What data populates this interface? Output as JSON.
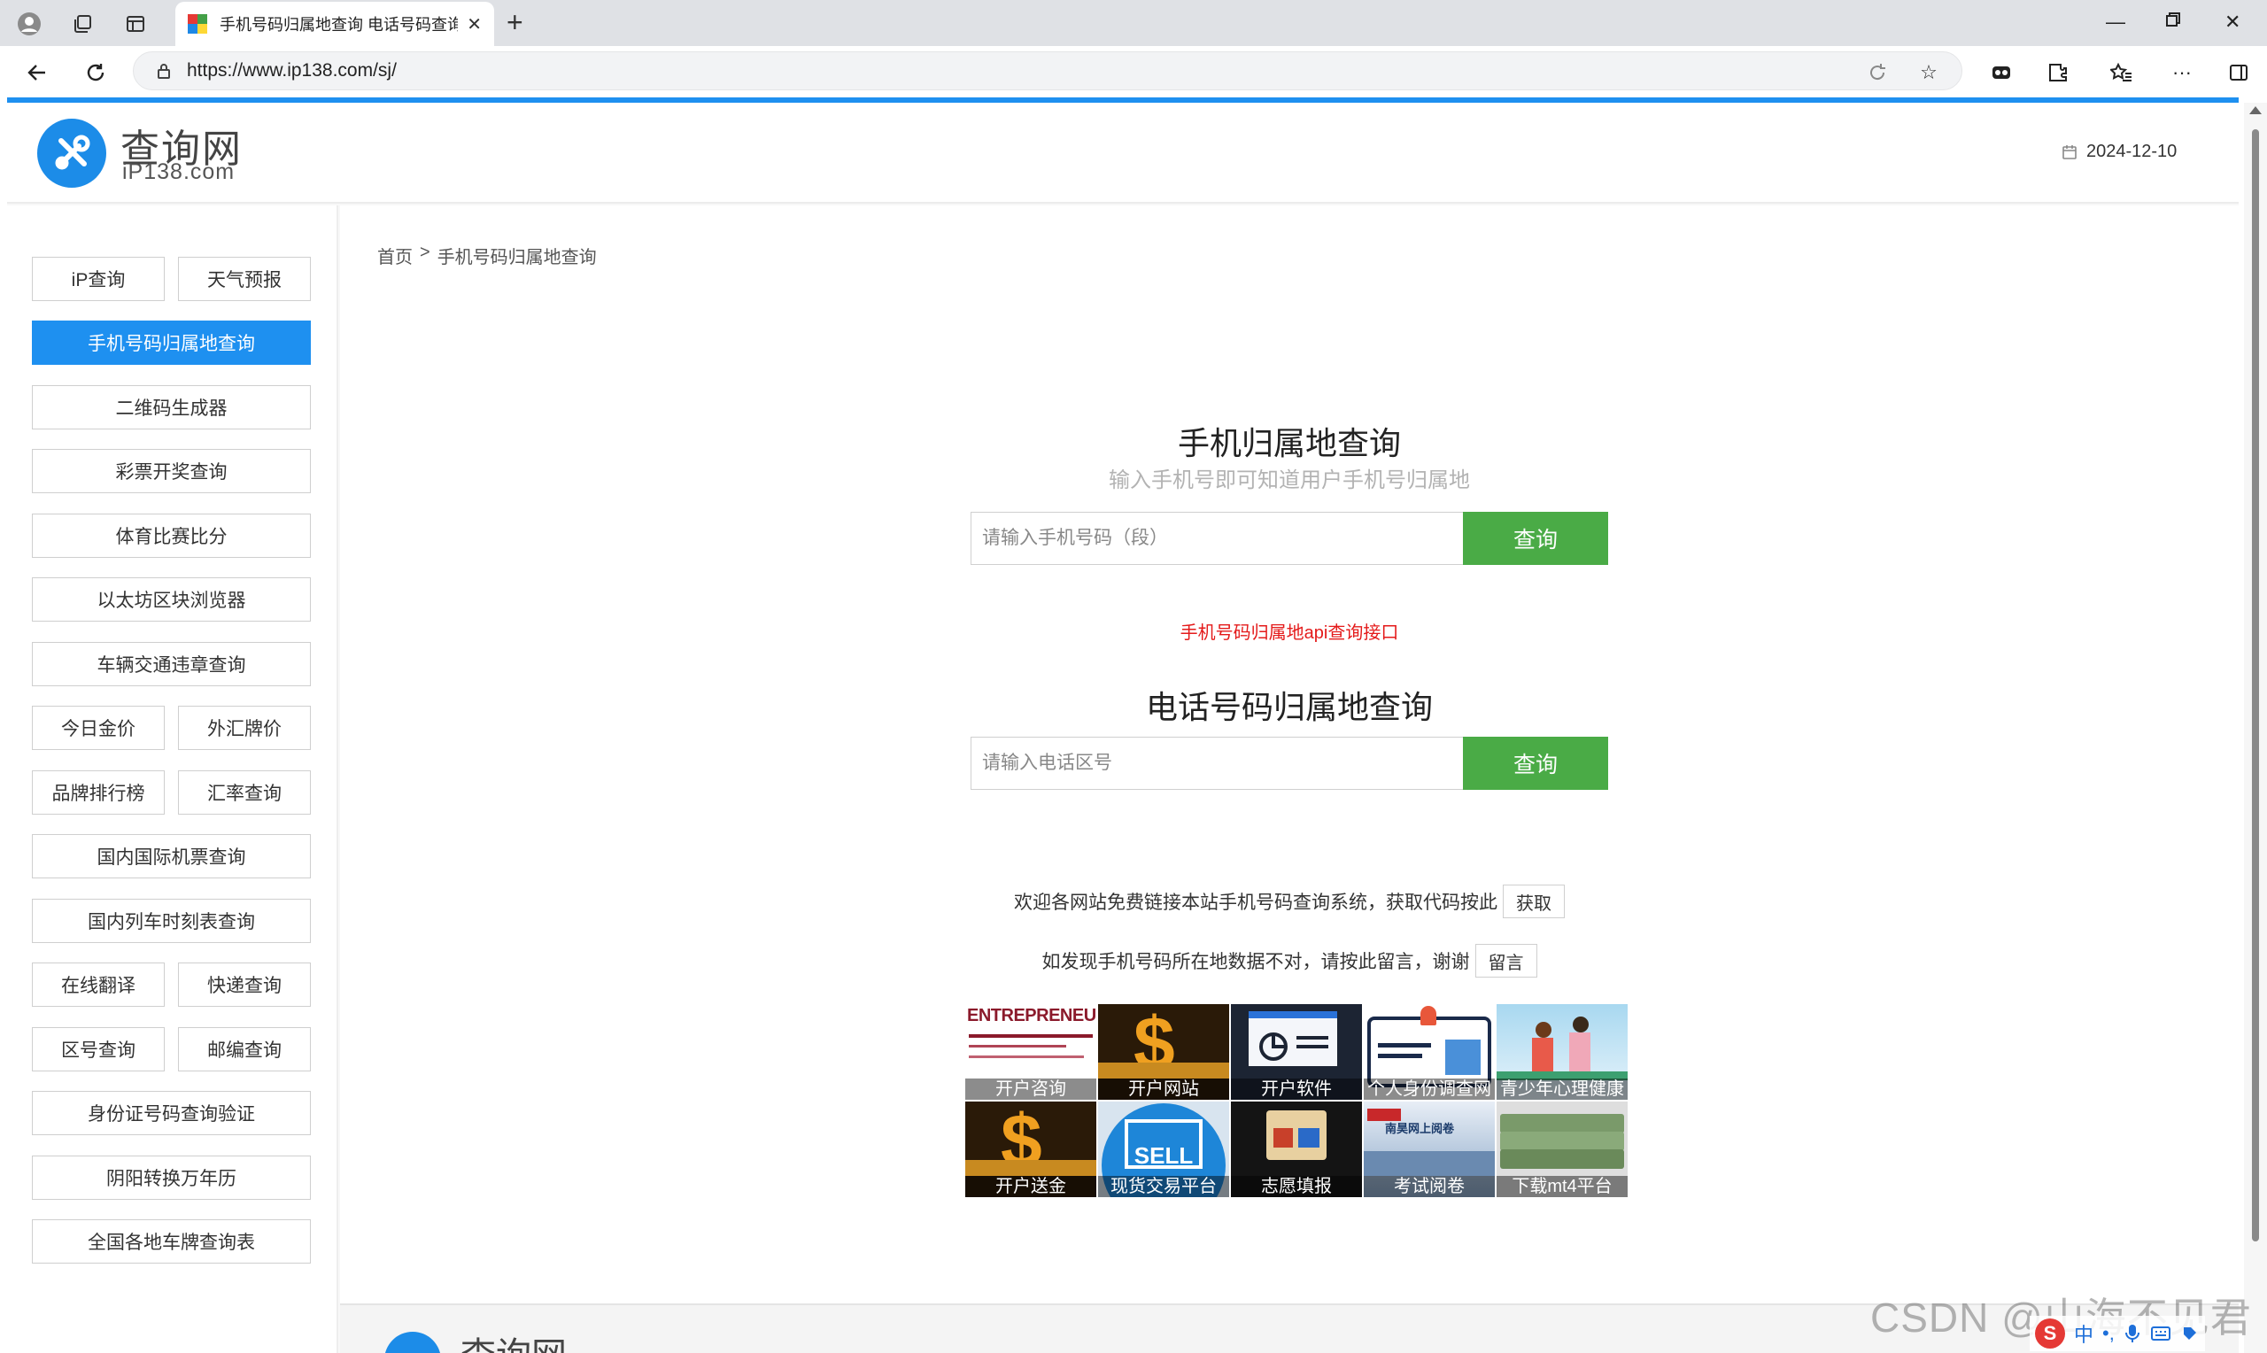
{
  "browser": {
    "tab_title": "手机号码归属地查询 电话号码查询",
    "url": "https://www.ip138.com/sj/"
  },
  "site": {
    "logo_cn": "查询网",
    "logo_en": "iP138.com",
    "date": "2024-12-10",
    "accent_color": "#1e90f0",
    "button_color": "#4aab46"
  },
  "sidebar": {
    "items": [
      {
        "label": "iP查询"
      },
      {
        "label": "天气预报"
      },
      {
        "label": "手机号码归属地查询",
        "active": true
      },
      {
        "label": "二维码生成器"
      },
      {
        "label": "彩票开奖查询"
      },
      {
        "label": "体育比赛比分"
      },
      {
        "label": "以太坊区块浏览器"
      },
      {
        "label": "车辆交通违章查询"
      },
      {
        "label": "今日金价"
      },
      {
        "label": "外汇牌价"
      },
      {
        "label": "品牌排行榜"
      },
      {
        "label": "汇率查询"
      },
      {
        "label": "国内国际机票查询"
      },
      {
        "label": "国内列车时刻表查询"
      },
      {
        "label": "在线翻译"
      },
      {
        "label": "快递查询"
      },
      {
        "label": "区号查询"
      },
      {
        "label": "邮编查询"
      },
      {
        "label": "身份证号码查询验证"
      },
      {
        "label": "阴阳转换万年历"
      },
      {
        "label": "全国各地车牌查询表"
      }
    ]
  },
  "breadcrumb": {
    "home": "首页",
    "separator": ">",
    "current": "手机号码归属地查询"
  },
  "mobile_query": {
    "title": "手机归属地查询",
    "subtitle": "输入手机号即可知道用户手机号归属地",
    "placeholder": "请输入手机号码（段）",
    "button": "查询"
  },
  "api_link": "手机号码归属地api查询接口",
  "phone_query": {
    "title": "电话号码归属地查询",
    "placeholder": "请输入电话区号",
    "button": "查询"
  },
  "notes": {
    "link_text": "欢迎各网站免费链接本站手机号码查询系统，获取代码按此",
    "link_button": "获取",
    "feedback_text": "如发现手机号码所在地数据不对，请按此留言，谢谢",
    "feedback_button": "留言"
  },
  "ads": [
    {
      "caption": "开户咨询",
      "banner": "ENTREPRENEUR"
    },
    {
      "caption": "开户网站"
    },
    {
      "caption": "开户软件"
    },
    {
      "caption": "个人身份调查网"
    },
    {
      "caption": "青少年心理健康"
    },
    {
      "caption": "开户送金"
    },
    {
      "caption": "现货交易平台",
      "banner": "SELL"
    },
    {
      "caption": "志愿填报"
    },
    {
      "caption": "考试阅卷",
      "banner": "南昊网上阅卷"
    },
    {
      "caption": "下载mt4平台"
    }
  ],
  "footer": {
    "logo_cn": "查询网"
  },
  "overlay": {
    "watermark": "CSDN @山海不见君",
    "ime_text": "中"
  }
}
